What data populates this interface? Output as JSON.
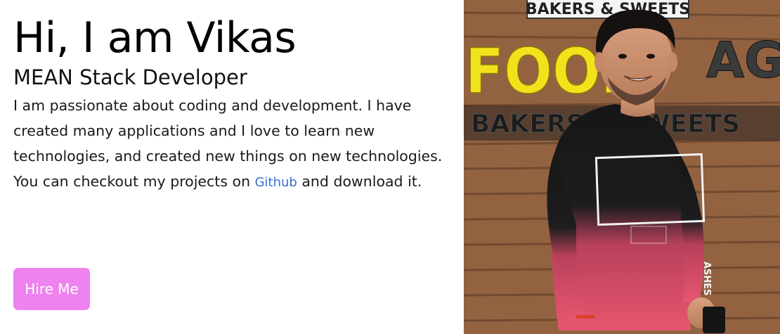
{
  "intro": {
    "name": "Hi, I am Vikas",
    "role": "MEAN Stack Developer",
    "bio_before_link": "I am passionate about coding and development. I have created many applications and I love to learn new technologies, and created new things on new technologies. You can checkout my projects on ",
    "link_label": "Github",
    "bio_after_link": " and download it."
  },
  "cta": {
    "hire_label": "Hire Me"
  },
  "photo": {
    "sign_top": "BAKERS & SWEETS",
    "sign_main_left": "FOOD",
    "sign_main_right": "AGE",
    "sign_bottom": "BAKERS & SWEETS",
    "shirt_caption": "ASHES"
  },
  "colors": {
    "accent": "#ee82ee",
    "link": "#3b6fd4",
    "sign_yellow": "#f2e21b",
    "wall_wood": "#8a5a3b",
    "shirt_top": "#1a1a1a",
    "shirt_bottom": "#e0506a"
  }
}
